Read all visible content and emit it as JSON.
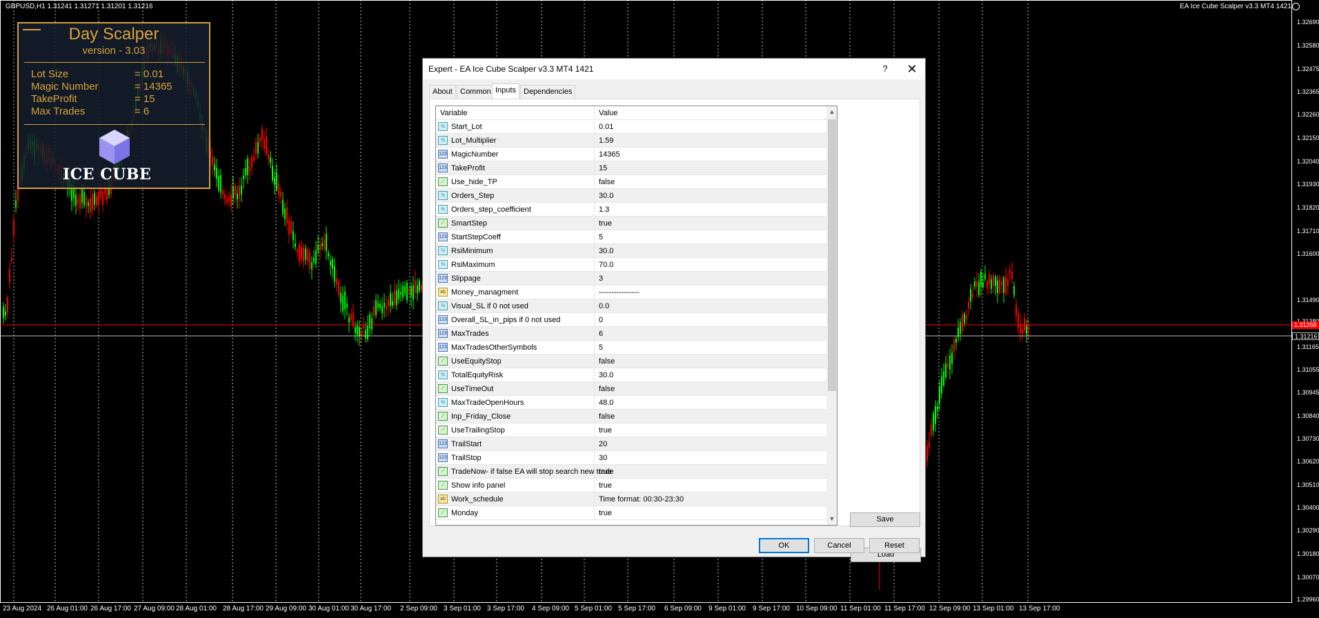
{
  "chart": {
    "symbol_line": "GBPUSD,H1  1.31241 1.31271 1.31201 1.31216",
    "ea_label": "EA Ice Cube Scalper v3.3 MT4 1421",
    "price_levels": [
      "1.32690",
      "1.32580",
      "1.32475",
      "1.32365",
      "1.32260",
      "1.32150",
      "1.32040",
      "1.31930",
      "1.31820",
      "1.31710",
      "1.31600",
      "1.31490",
      "1.31380",
      "1.31268",
      "1.31216",
      "1.31165",
      "1.31055",
      "1.30945",
      "1.30840",
      "1.30730",
      "1.30620",
      "1.30510",
      "1.30400",
      "1.30290",
      "1.30180",
      "1.30070",
      "1.29960"
    ],
    "current_bid": "1.31216",
    "current_ask": "1.31268",
    "dates": [
      "23 Aug 2024",
      "26 Aug 01:00",
      "26 Aug 17:00",
      "27 Aug 09:00",
      "28 Aug 01:00",
      "28 Aug 17:00",
      "29 Aug 09:00",
      "30 Aug 01:00",
      "30 Aug 17:00",
      "2 Sep 09:00",
      "3 Sep 01:00",
      "3 Sep 17:00",
      "4 Sep 09:00",
      "5 Sep 01:00",
      "5 Sep 17:00",
      "6 Sep 09:00",
      "9 Sep 01:00",
      "9 Sep 17:00",
      "10 Sep 09:00",
      "11 Sep 01:00",
      "11 Sep 17:00",
      "12 Sep 09:00",
      "13 Sep 01:00",
      "13 Sep 17:00"
    ],
    "colors": {
      "bull": "#00ff00",
      "bear": "#ff0000",
      "bid_line": "#c0c0c0",
      "ask_line": "#ff0000",
      "grid": "#ffffff"
    }
  },
  "info_panel": {
    "title": "Day Scalper",
    "version": "version - 3.03",
    "rows": [
      {
        "key": "Lot Size",
        "value": "= 0.01"
      },
      {
        "key": "Magic Number",
        "value": "= 14365"
      },
      {
        "key": "TakeProfit",
        "value": "= 15"
      },
      {
        "key": "Max Trades",
        "value": "= 6"
      }
    ],
    "logo_text": "ICE CUBE",
    "accent_color": "#d9a33a"
  },
  "dialog": {
    "title": "Expert - EA Ice Cube Scalper v3.3 MT4 1421",
    "help_label": "?",
    "close_label": "✕",
    "tabs": [
      {
        "label": "About",
        "active": false
      },
      {
        "label": "Common",
        "active": false
      },
      {
        "label": "Inputs",
        "active": true
      },
      {
        "label": "Dependencies",
        "active": false
      }
    ],
    "grid_headers": {
      "variable": "Variable",
      "value": "Value"
    },
    "inputs": [
      {
        "type": "dbl",
        "icon": "½",
        "name": "Start_Lot",
        "value": "0.01"
      },
      {
        "type": "dbl",
        "icon": "½",
        "name": "Lot_Multiplier",
        "value": "1.59"
      },
      {
        "type": "num",
        "icon": "123",
        "name": "MagicNumber",
        "value": "14365"
      },
      {
        "type": "num",
        "icon": "123",
        "name": "TakeProfit",
        "value": "15"
      },
      {
        "type": "bool",
        "icon": "⟋",
        "name": "Use_hide_TP",
        "value": "false"
      },
      {
        "type": "dbl",
        "icon": "½",
        "name": "Orders_Step",
        "value": "30.0"
      },
      {
        "type": "dbl",
        "icon": "½",
        "name": "Orders_step_coefficient",
        "value": "1.3"
      },
      {
        "type": "bool",
        "icon": "⟋",
        "name": "SmartStep",
        "value": "true"
      },
      {
        "type": "num",
        "icon": "123",
        "name": "StartStepCoeff",
        "value": "5"
      },
      {
        "type": "dbl",
        "icon": "½",
        "name": "RsiMinimum",
        "value": "30.0"
      },
      {
        "type": "dbl",
        "icon": "½",
        "name": "RsiMaximum",
        "value": "70.0"
      },
      {
        "type": "num",
        "icon": "123",
        "name": "Slippage",
        "value": "3"
      },
      {
        "type": "str",
        "icon": "ab",
        "name": "Money_managment",
        "value": "----------------"
      },
      {
        "type": "dbl",
        "icon": "½",
        "name": "Visual_SL if 0 not used",
        "value": "0.0"
      },
      {
        "type": "num",
        "icon": "123",
        "name": "Overall_SL_in_pips if 0 not used",
        "value": "0"
      },
      {
        "type": "num",
        "icon": "123",
        "name": "MaxTrades",
        "value": "6"
      },
      {
        "type": "num",
        "icon": "123",
        "name": "MaxTradesOtherSymbols",
        "value": "5"
      },
      {
        "type": "bool",
        "icon": "⟋",
        "name": "UseEquityStop",
        "value": "false"
      },
      {
        "type": "dbl",
        "icon": "½",
        "name": "TotalEquityRisk",
        "value": "30.0"
      },
      {
        "type": "bool",
        "icon": "⟋",
        "name": "UseTimeOut",
        "value": "false"
      },
      {
        "type": "dbl",
        "icon": "½",
        "name": "MaxTradeOpenHours",
        "value": "48.0"
      },
      {
        "type": "bool",
        "icon": "⟋",
        "name": "Inp_Friday_Close",
        "value": "false"
      },
      {
        "type": "bool",
        "icon": "⟋",
        "name": "UseTrailingStop",
        "value": "true"
      },
      {
        "type": "num",
        "icon": "123",
        "name": "TrailStart",
        "value": "20"
      },
      {
        "type": "num",
        "icon": "123",
        "name": "TrailStop",
        "value": "30"
      },
      {
        "type": "bool",
        "icon": "⟋",
        "name": "TradeNow- if false EA will stop search new trade",
        "value": "true"
      },
      {
        "type": "bool",
        "icon": "⟋",
        "name": "Show info panel",
        "value": "true"
      },
      {
        "type": "str",
        "icon": "ab",
        "name": "Work_schedule",
        "value": "Time format: 00:30-23:30"
      },
      {
        "type": "bool",
        "icon": "⟋",
        "name": "Monday",
        "value": "true"
      }
    ],
    "load_label": "Load",
    "save_label": "Save",
    "ok_label": "OK",
    "cancel_label": "Cancel",
    "reset_label": "Reset"
  }
}
